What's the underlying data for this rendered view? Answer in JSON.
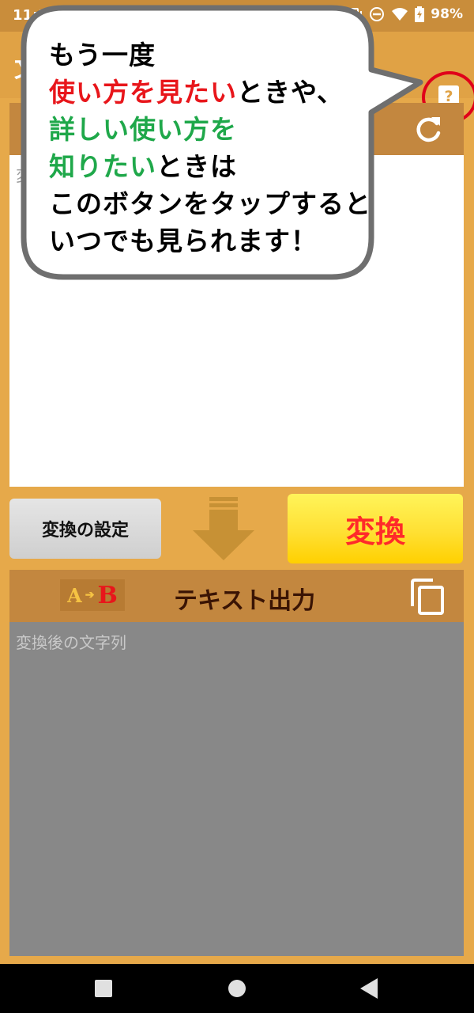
{
  "status_bar": {
    "time": "11:57",
    "battery": "98%"
  },
  "app_bar": {
    "title": "文",
    "help_icon": "help-icon"
  },
  "input_panel": {
    "refresh_icon": "refresh-icon",
    "placeholder": "変"
  },
  "controls": {
    "settings_label": "変換の設定",
    "convert_label": "変換"
  },
  "output_panel": {
    "badge_a": "A",
    "badge_b": "B",
    "title": "テキスト出力",
    "copy_icon": "copy-icon",
    "placeholder": "変換後の文字列"
  },
  "bubble": {
    "line1": "もう一度",
    "line2_red": "使い方を見たい",
    "line2_tail": "ときや、",
    "line3_green": "詳しい使い方を",
    "line4_green": "知りたい",
    "line4_tail": "ときは",
    "line5": "このボタンをタップすると",
    "line6": "いつでも見られます！"
  },
  "colors": {
    "background": "#e6a94a",
    "panel_header": "#c3873f",
    "convert_text": "#ff2a2a",
    "highlight_red": "#e8161b",
    "highlight_green": "#1fa84a"
  }
}
